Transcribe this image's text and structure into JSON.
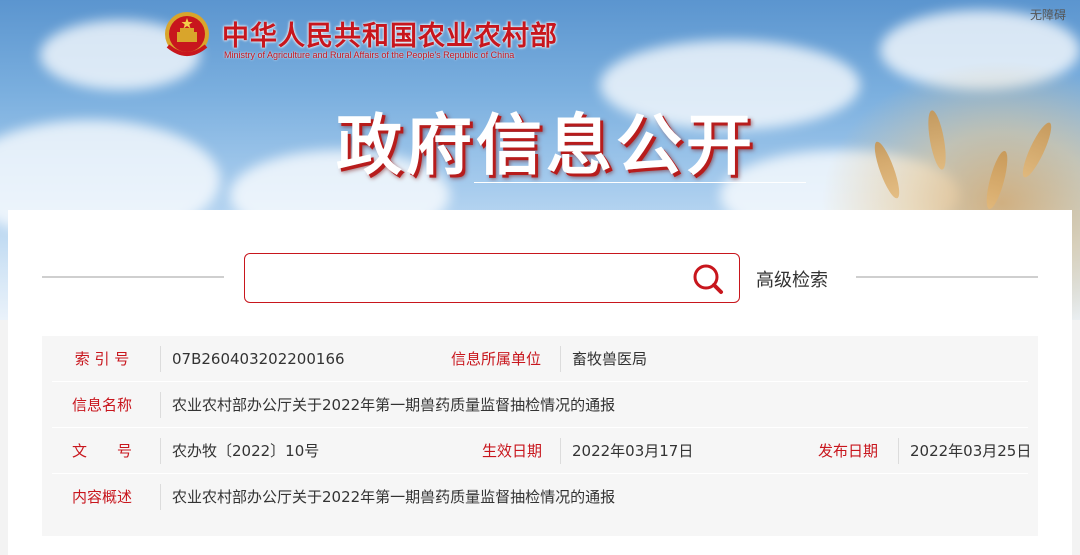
{
  "header": {
    "ministry_cn": "中华人民共和国农业农村部",
    "ministry_en": "Ministry of Agriculture and Rural Affairs of the People's Republic of China",
    "accessibility": "无障碍",
    "page_title": "政府信息公开"
  },
  "search": {
    "value": "",
    "placeholder": "",
    "advanced_label": "高级检索"
  },
  "info": {
    "index_label": "索 引 号",
    "index_value": "07B260403202200166",
    "unit_label": "信息所属单位",
    "unit_value": "畜牧兽医局",
    "name_label": "信息名称",
    "name_value": "农业农村部办公厅关于2022年第一期兽药质量监督抽检情况的通报",
    "doc_label": "文　　号",
    "doc_value": "农办牧〔2022〕10号",
    "effective_label": "生效日期",
    "effective_value": "2022年03月17日",
    "publish_label": "发布日期",
    "publish_value": "2022年03月25日",
    "summary_label": "内容概述",
    "summary_value": "农业农村部办公厅关于2022年第一期兽药质量监督抽检情况的通报"
  },
  "colors": {
    "brand_red": "#c8161d",
    "sky_blue": "#6fa6da"
  }
}
